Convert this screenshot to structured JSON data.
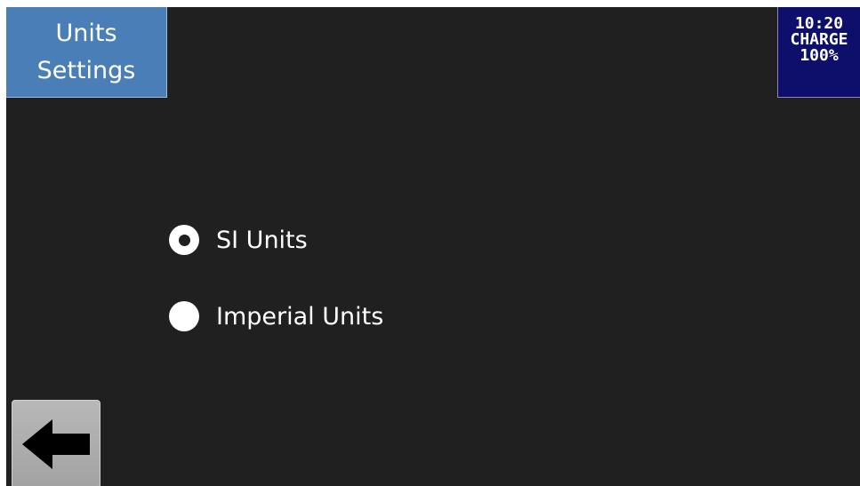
{
  "header": {
    "title_line1": "Units",
    "title_line2": "Settings"
  },
  "status": {
    "time": "10:20",
    "charge_label": "CHARGE",
    "charge_value": "100%"
  },
  "units_options": [
    {
      "label": "SI Units",
      "selected": true
    },
    {
      "label": "Imperial Units",
      "selected": false
    }
  ],
  "navigation": {
    "back_icon": "arrow-left-icon"
  },
  "colors": {
    "background": "#202020",
    "title_bg": "#4a7eb6",
    "status_bg": "#0e0f6a",
    "back_button_bg": "#b0b0b0"
  }
}
